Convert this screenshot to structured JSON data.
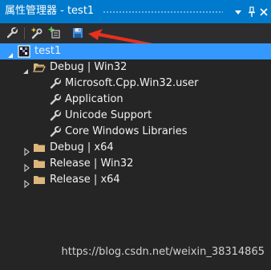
{
  "window": {
    "title": "属性管理器 - test1",
    "pin_icon": "pin-icon",
    "dropdown_icon": "dropdown-icon",
    "close_icon": "close-icon"
  },
  "toolbar": {
    "buttons": [
      {
        "name": "properties-button",
        "icon": "wrench-icon"
      },
      {
        "name": "add-new-property-sheet-button",
        "icon": "wrench-star-icon"
      },
      {
        "name": "add-existing-property-sheet-button",
        "icon": "add-sheet-icon"
      },
      {
        "name": "save-button",
        "icon": "floppy-disk-icon"
      }
    ]
  },
  "tree": {
    "project": {
      "label": "test1",
      "expanded": true,
      "selected": true
    },
    "configs": [
      {
        "label": "Debug | Win32",
        "expanded": true,
        "sheets": [
          {
            "label": "Microsoft.Cpp.Win32.user"
          },
          {
            "label": "Application"
          },
          {
            "label": "Unicode Support"
          },
          {
            "label": "Core Windows Libraries"
          }
        ]
      },
      {
        "label": "Debug | x64",
        "expanded": false
      },
      {
        "label": "Release | Win32",
        "expanded": false
      },
      {
        "label": "Release | x64",
        "expanded": false
      }
    ]
  },
  "watermark": "https://blog.csdn.net/weixin_38314865",
  "colors": {
    "titlebar": "#007acc",
    "background": "#252526",
    "selection": "#3399ff",
    "folder": "#dcb67a",
    "annotation_arrow": "#e8301c"
  }
}
